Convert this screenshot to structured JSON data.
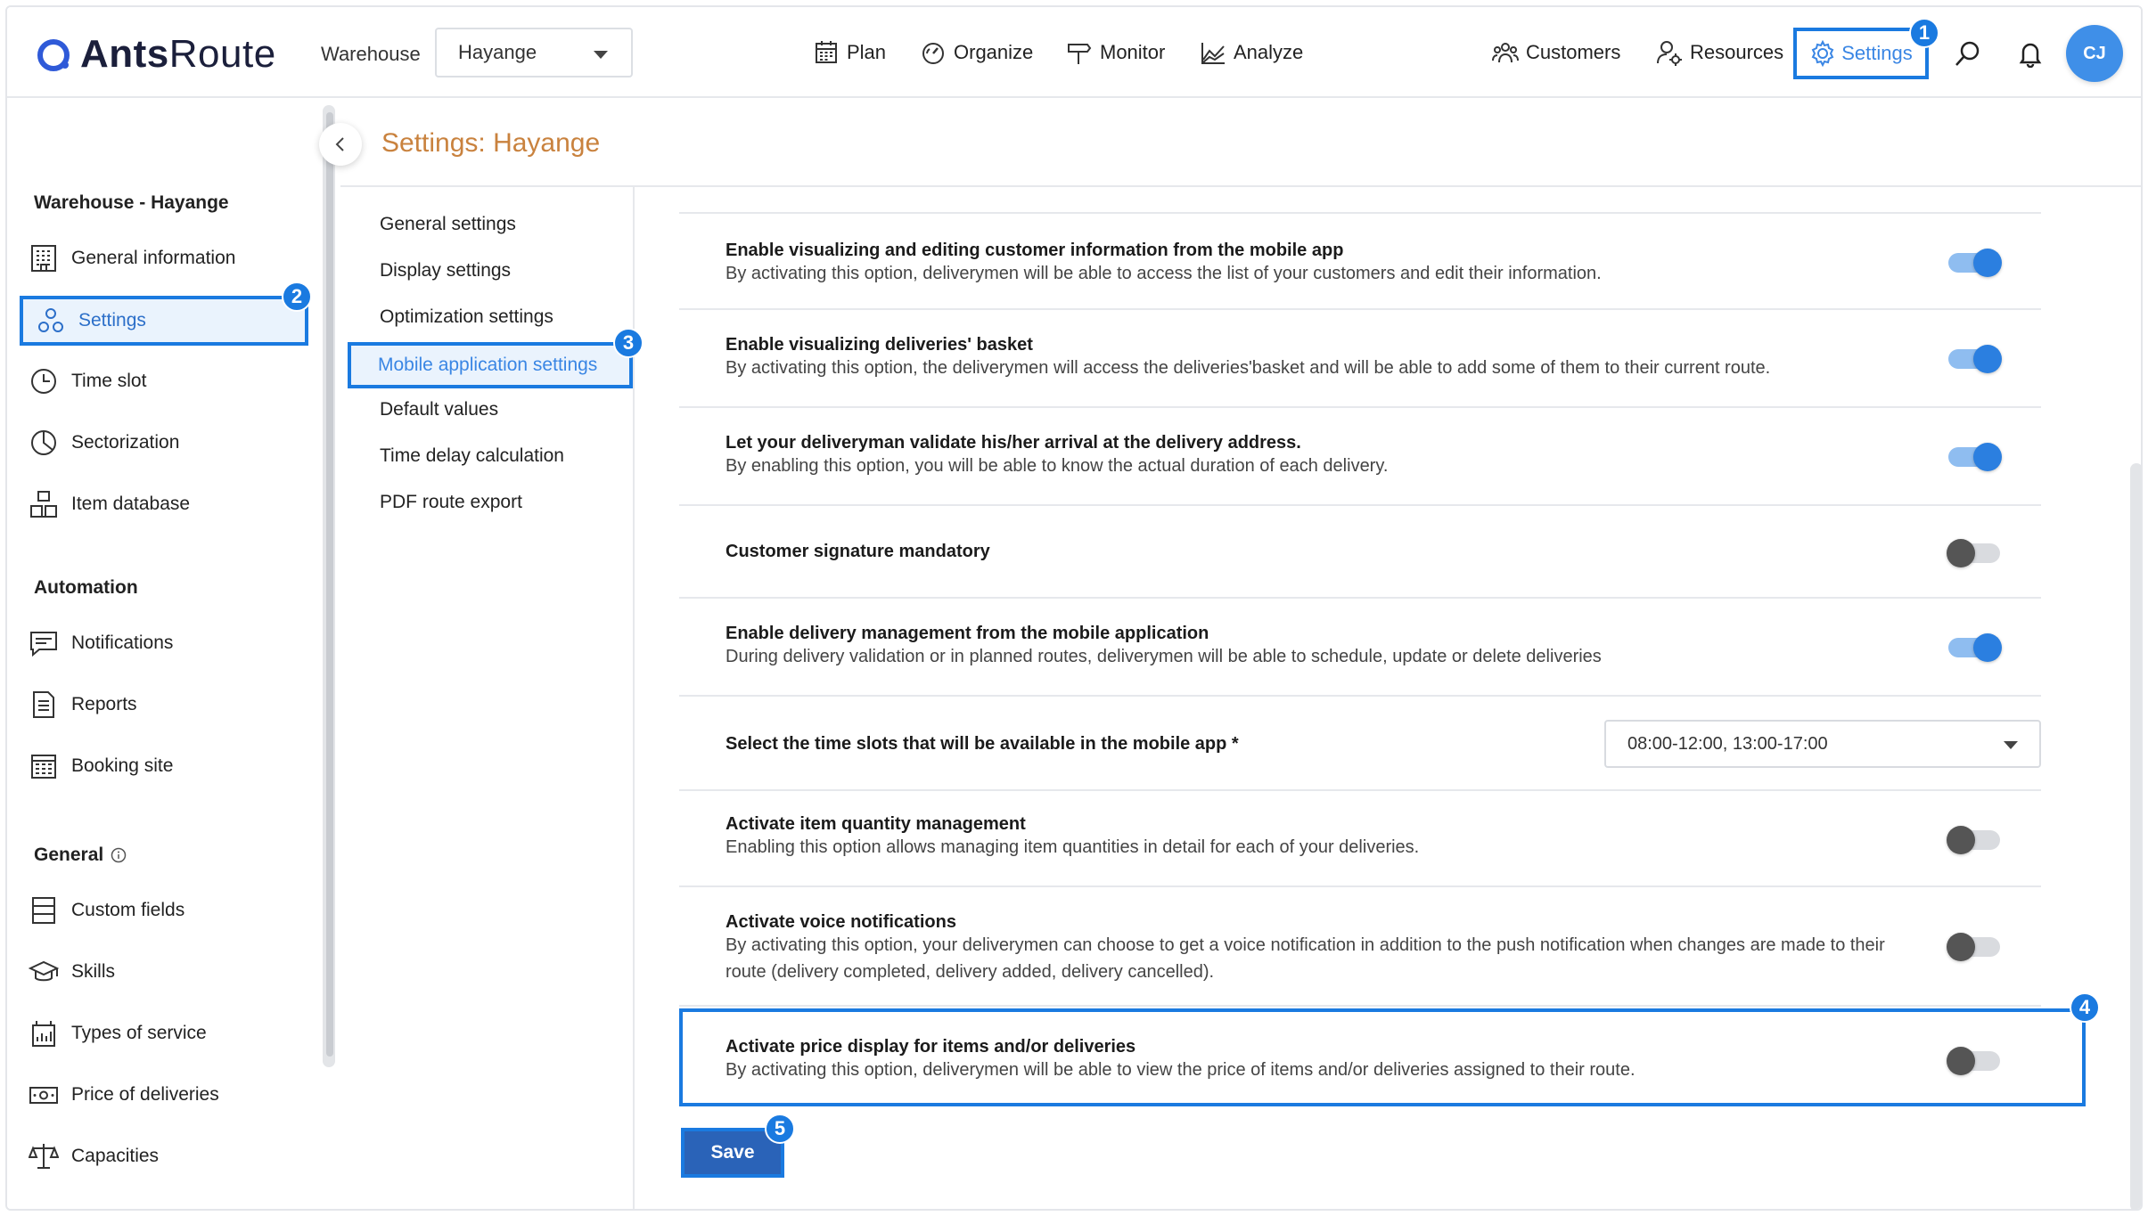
{
  "brand": {
    "name_bold": "Ants",
    "name_light": "Route"
  },
  "header": {
    "warehouse_label": "Warehouse",
    "warehouse_value": "Hayange",
    "nav": [
      {
        "label": "Plan",
        "icon": "calendar-icon"
      },
      {
        "label": "Organize",
        "icon": "gauge-icon"
      },
      {
        "label": "Monitor",
        "icon": "signpost-icon"
      },
      {
        "label": "Analyze",
        "icon": "chart-icon"
      }
    ],
    "right_nav": [
      {
        "label": "Customers",
        "icon": "group-icon"
      },
      {
        "label": "Resources",
        "icon": "user-gear-icon"
      },
      {
        "label": "Settings",
        "icon": "gear-icon"
      }
    ],
    "avatar_initials": "CJ"
  },
  "badges": {
    "b1": "1",
    "b2": "2",
    "b3": "3",
    "b4": "4",
    "b5": "5"
  },
  "sidebar": {
    "section_warehouse": "Warehouse - Hayange",
    "warehouse_items": [
      {
        "label": "General information",
        "icon": "building-icon"
      },
      {
        "label": "Settings",
        "icon": "gears-icon"
      },
      {
        "label": "Time slot",
        "icon": "clock-icon"
      },
      {
        "label": "Sectorization",
        "icon": "pie-icon"
      },
      {
        "label": "Item database",
        "icon": "boxes-icon"
      }
    ],
    "section_automation": "Automation",
    "automation_items": [
      {
        "label": "Notifications",
        "icon": "message-icon"
      },
      {
        "label": "Reports",
        "icon": "document-icon"
      },
      {
        "label": "Booking site",
        "icon": "calendar-grid-icon"
      }
    ],
    "section_general": "General",
    "general_items": [
      {
        "label": "Custom fields",
        "icon": "fields-icon"
      },
      {
        "label": "Skills",
        "icon": "graduation-icon"
      },
      {
        "label": "Types of service",
        "icon": "bar-chart-icon"
      },
      {
        "label": "Price of deliveries",
        "icon": "banknote-icon"
      },
      {
        "label": "Capacities",
        "icon": "scale-icon"
      }
    ]
  },
  "page": {
    "title": "Settings: Hayange"
  },
  "settings_menu": [
    "General settings",
    "Display settings",
    "Optimization settings",
    "Mobile application settings",
    "Default values",
    "Time delay calculation",
    "PDF route export"
  ],
  "options": [
    {
      "title": "Enable visualizing and editing customer information from the mobile app",
      "desc": "By activating this option, deliverymen will be able to access the list of your customers and edit their information.",
      "enabled": true
    },
    {
      "title": "Enable visualizing deliveries' basket",
      "desc": "By activating this option, the deliverymen will access the deliveries'basket and will be able to add some of them to their current route.",
      "enabled": true
    },
    {
      "title": "Let your deliveryman validate his/her arrival at the delivery address.",
      "desc": "By enabling this option, you will be able to know the actual duration of each delivery.",
      "enabled": true
    },
    {
      "title": "Customer signature mandatory",
      "desc": "",
      "enabled": false
    },
    {
      "title": "Enable delivery management from the mobile application",
      "desc": "During delivery validation or in planned routes, deliverymen will be able to schedule, update or delete deliveries",
      "enabled": true
    },
    {
      "title": "Select the time slots that will be available in the mobile app *",
      "select_value": "08:00-12:00, 13:00-17:00"
    },
    {
      "title": "Activate item quantity management",
      "desc": "Enabling this option allows managing item quantities in detail for each of your deliveries.",
      "enabled": false
    },
    {
      "title": "Activate voice notifications",
      "desc": "By activating this option, your deliverymen can choose to get a voice notification in addition to the push notification when changes are made to their route (delivery completed, delivery added, delivery cancelled).",
      "enabled": false
    },
    {
      "title": "Activate price display for items and/or deliveries",
      "desc": "By activating this option, deliverymen will be able to view the price of items and/or deliveries assigned to their route.",
      "enabled": false
    }
  ],
  "save_label": "Save",
  "colors": {
    "accent": "#1a7ae0",
    "title": "#c9823e",
    "toggle_on": "#2b7fe0",
    "save": "#2a63b8"
  }
}
